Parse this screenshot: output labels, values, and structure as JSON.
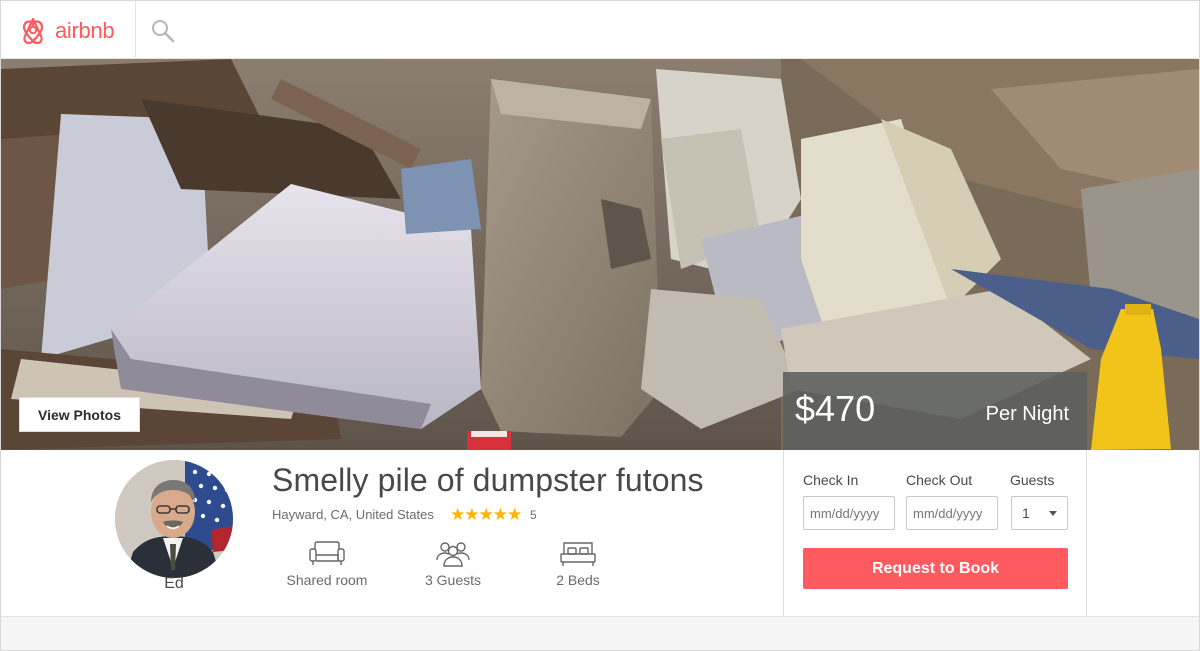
{
  "header": {
    "brand": "airbnb",
    "brand_color": "#ff5a5f",
    "logo_icon": "airbnb-belo-icon",
    "search_icon": "search-icon"
  },
  "hero": {
    "view_photos_label": "View Photos"
  },
  "booking": {
    "price": "$470",
    "per_night": "Per Night",
    "check_in_label": "Check In",
    "check_out_label": "Check Out",
    "guests_label": "Guests",
    "check_in_placeholder": "mm/dd/yyyy",
    "check_out_placeholder": "mm/dd/yyyy",
    "guests_value": "1",
    "request_label": "Request to Book",
    "button_color": "#ff5a5f"
  },
  "host": {
    "name": "Ed"
  },
  "listing": {
    "title": "Smelly pile of dumpster futons",
    "location": "Hayward, CA, United States",
    "rating_stars": "★★★★★",
    "rating_value": 5,
    "review_count": "5",
    "amenities": [
      {
        "icon": "couch-icon",
        "label": "Shared room"
      },
      {
        "icon": "guests-icon",
        "label": "3 Guests"
      },
      {
        "icon": "bed-icon",
        "label": "2 Beds"
      }
    ]
  }
}
